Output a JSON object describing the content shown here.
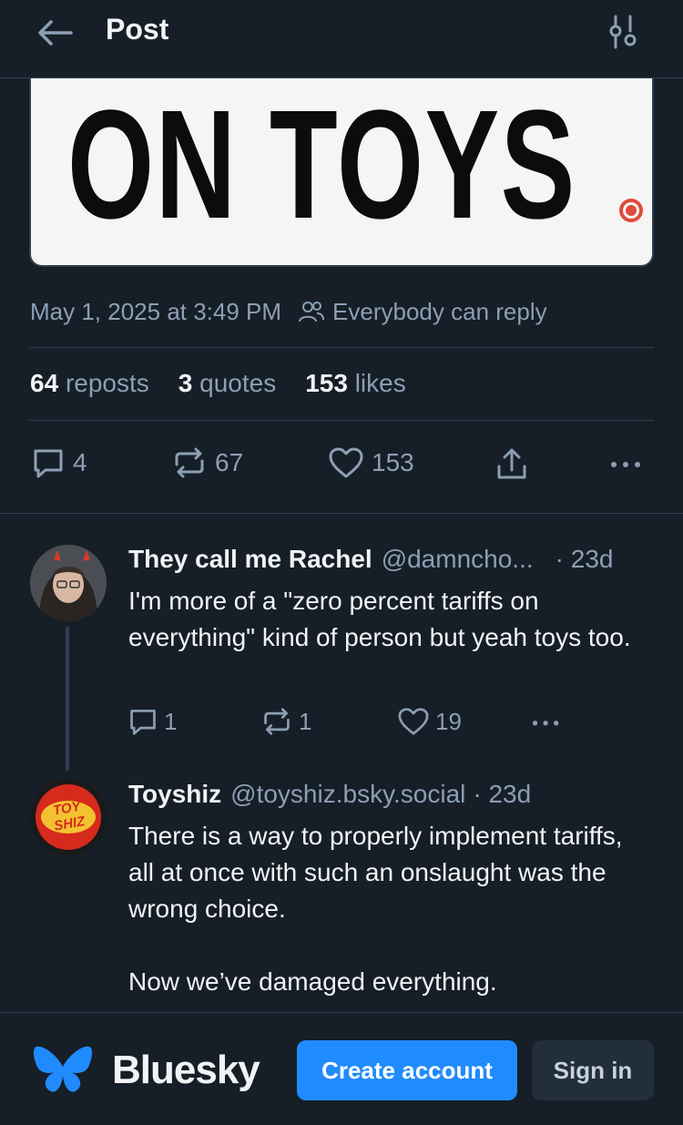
{
  "topbar": {
    "title": "Post"
  },
  "post": {
    "image_text": "ON TOYS",
    "date": "May 1, 2025 at 3:49 PM",
    "reply_setting": "Everybody can reply",
    "stats": [
      {
        "count": "64",
        "label": "reposts"
      },
      {
        "count": "3",
        "label": "quotes"
      },
      {
        "count": "153",
        "label": "likes"
      }
    ],
    "actions": {
      "replies": "4",
      "reposts": "67",
      "likes": "153"
    }
  },
  "replies": [
    {
      "name": "They call me Rachel",
      "handle": "@damncho...",
      "time": "· 23d",
      "text": "I'm more of a \"zero percent tariffs on everything\" kind of person but yeah toys too.",
      "actions": {
        "replies": "1",
        "reposts": "1",
        "likes": "19"
      }
    },
    {
      "name": "Toyshiz",
      "handle": "@toyshiz.bsky.social",
      "time": "· 23d",
      "text": "There is a way to properly implement tariffs, all at once with such an onslaught was the wrong choice.\n\nNow we’ve damaged everything.",
      "avatar_text": "TOY SHIZ"
    }
  ],
  "footer": {
    "brand": "Bluesky",
    "create_label": "Create account",
    "signin_label": "Sign in"
  },
  "colors": {
    "background": "#161e27",
    "accent": "#208bfe",
    "muted_text": "#8c9fb4",
    "border": "#2e4052"
  }
}
